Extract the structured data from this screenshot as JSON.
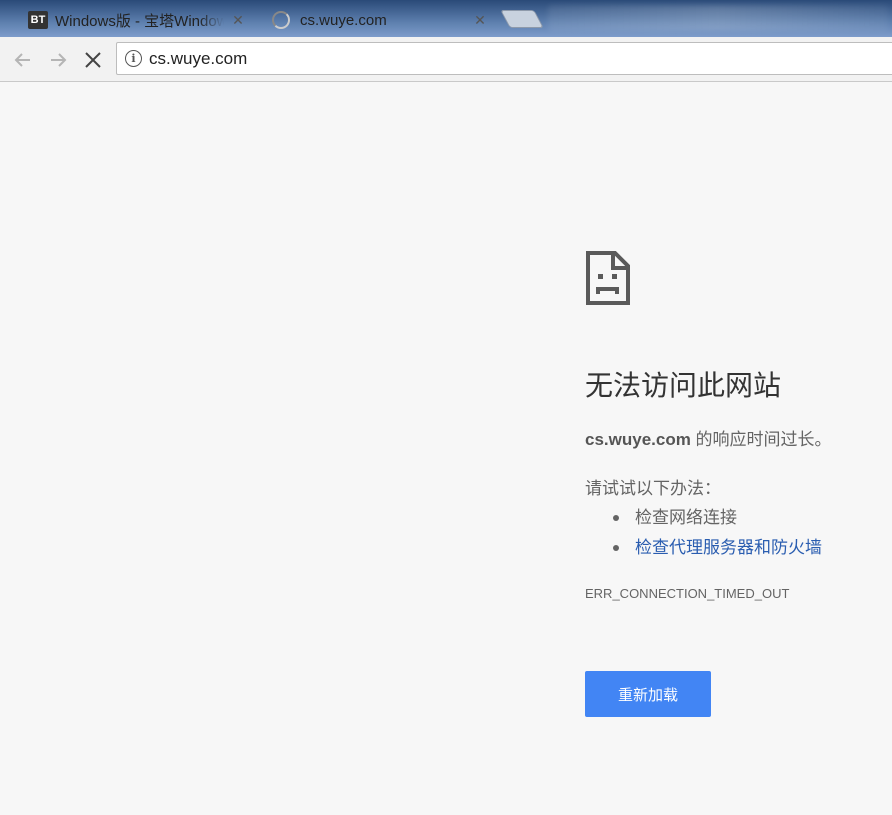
{
  "tabs": [
    {
      "favicon": "BT",
      "title": "Windows版 - 宝塔Windows面板",
      "close": "✕"
    },
    {
      "title": "cs.wuye.com",
      "close": "✕",
      "loading": true
    }
  ],
  "toolbar": {
    "url": "cs.wuye.com"
  },
  "error": {
    "headline": "无法访问此网站",
    "host": "cs.wuye.com",
    "detail_suffix": " 的响应时间过长。",
    "try_label": "请试试以下办法：",
    "suggestions": [
      {
        "text": "检查网络连接",
        "is_link": false
      },
      {
        "text": "检查代理服务器和防火墙",
        "is_link": true
      }
    ],
    "code": "ERR_CONNECTION_TIMED_OUT",
    "reload_label": "重新加载"
  },
  "colors": {
    "page_bg": "#f7f7f7",
    "button_blue": "#4285f4",
    "link_blue": "#2a5db0",
    "text_gray": "#646464"
  }
}
